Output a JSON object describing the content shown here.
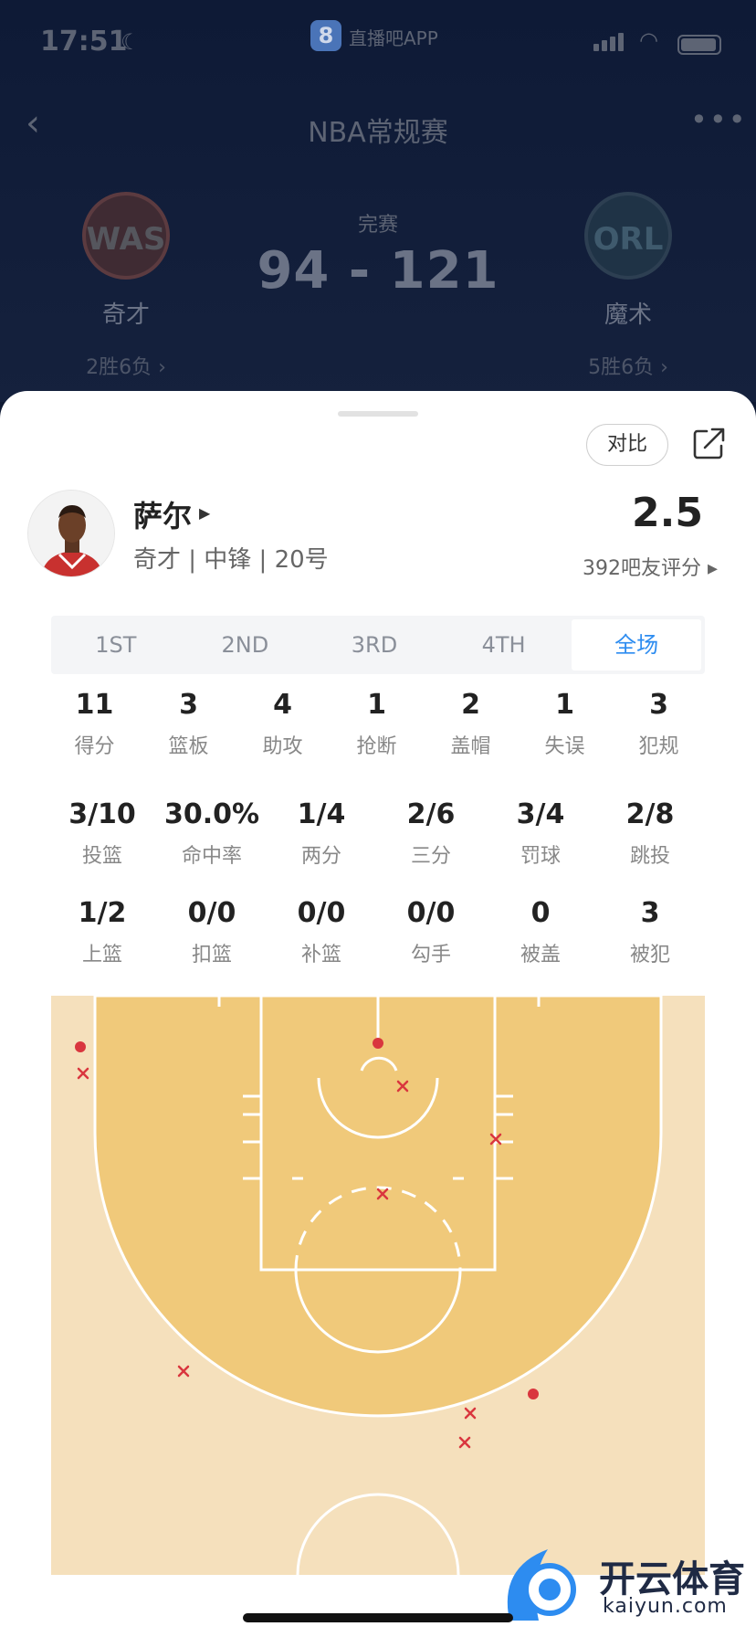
{
  "status_bar": {
    "time": "17:51",
    "app_badge": "8",
    "app_name": "直播吧APP"
  },
  "header": {
    "league": "NBA常规赛",
    "match_status": "完赛",
    "score": "94 - 121",
    "home": {
      "abbr": "WAS",
      "name": "奇才",
      "record": "2胜6负 ›"
    },
    "away": {
      "abbr": "ORL",
      "name": "魔术",
      "record": "5胜6负 ›"
    }
  },
  "sheet": {
    "compare_label": "对比",
    "player": {
      "name": "萨尔",
      "info": "奇才 | 中锋 | 20号"
    },
    "rating": {
      "value": "2.5",
      "count_label": "392吧友评分 ▸"
    },
    "tabs": [
      {
        "label": "1ST",
        "active": false
      },
      {
        "label": "2ND",
        "active": false
      },
      {
        "label": "3RD",
        "active": false
      },
      {
        "label": "4TH",
        "active": false
      },
      {
        "label": "全场",
        "active": true
      }
    ],
    "stats_row1": [
      {
        "v": "11",
        "l": "得分"
      },
      {
        "v": "3",
        "l": "篮板"
      },
      {
        "v": "4",
        "l": "助攻"
      },
      {
        "v": "1",
        "l": "抢断"
      },
      {
        "v": "2",
        "l": "盖帽"
      },
      {
        "v": "1",
        "l": "失误"
      },
      {
        "v": "3",
        "l": "犯规"
      }
    ],
    "stats_row2": [
      {
        "v": "3/10",
        "l": "投篮"
      },
      {
        "v": "30.0%",
        "l": "命中率"
      },
      {
        "v": "1/4",
        "l": "两分"
      },
      {
        "v": "2/6",
        "l": "三分"
      },
      {
        "v": "3/4",
        "l": "罚球"
      },
      {
        "v": "2/8",
        "l": "跳投"
      }
    ],
    "stats_row3": [
      {
        "v": "1/2",
        "l": "上篮"
      },
      {
        "v": "0/0",
        "l": "扣篮"
      },
      {
        "v": "0/0",
        "l": "补篮"
      },
      {
        "v": "0/0",
        "l": "勾手"
      },
      {
        "v": "0",
        "l": "被盖"
      },
      {
        "v": "3",
        "l": "被犯"
      }
    ]
  },
  "watermark": {
    "brand": "开云体育",
    "url": "kaiyun.com"
  },
  "colors": {
    "accent": "#2d8cf0",
    "court_paint": "#f0c97a",
    "court_outer": "#f5e0bc",
    "shot_marker": "#d9363e"
  }
}
